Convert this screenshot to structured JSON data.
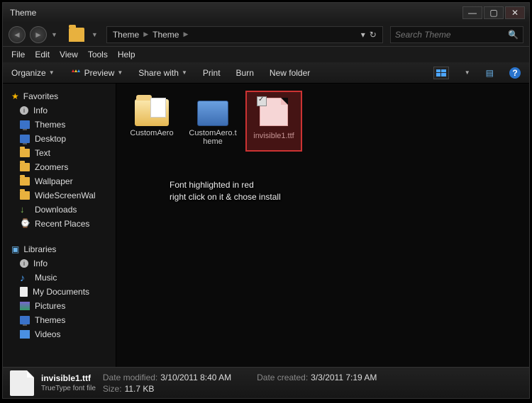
{
  "titlebar": {
    "title": "Theme"
  },
  "nav": {
    "breadcrumb": [
      "Theme",
      "Theme"
    ],
    "search_placeholder": "Search Theme"
  },
  "menu": {
    "file": "File",
    "edit": "Edit",
    "view": "View",
    "tools": "Tools",
    "help": "Help"
  },
  "toolbar": {
    "organize": "Organize",
    "preview": "Preview",
    "share": "Share with",
    "print": "Print",
    "burn": "Burn",
    "newfolder": "New folder"
  },
  "sidebar": {
    "favorites_label": "Favorites",
    "favorites": [
      "Info",
      "Themes",
      "Desktop",
      "Text",
      "Zoomers",
      "Wallpaper",
      "WideScreenWal",
      "Downloads",
      "Recent Places"
    ],
    "libraries_label": "Libraries",
    "libraries": [
      "Info",
      "Music",
      "My Documents",
      "Pictures",
      "Themes",
      "Videos"
    ]
  },
  "files": [
    {
      "name": "CustomAero",
      "kind": "folder"
    },
    {
      "name": "CustomAero.theme",
      "kind": "themefile"
    },
    {
      "name": "invisible1.ttf",
      "kind": "ttf",
      "highlighted": true
    }
  ],
  "annotation": {
    "line1": "Font highlighted in red",
    "line2": "right click on it & chose install"
  },
  "status": {
    "name": "invisible1.ttf",
    "type": "TrueType font file",
    "modified_lbl": "Date modified:",
    "modified_val": "3/10/2011 8:40 AM",
    "size_lbl": "Size:",
    "size_val": "11.7 KB",
    "created_lbl": "Date created:",
    "created_val": "3/3/2011 7:19 AM"
  }
}
